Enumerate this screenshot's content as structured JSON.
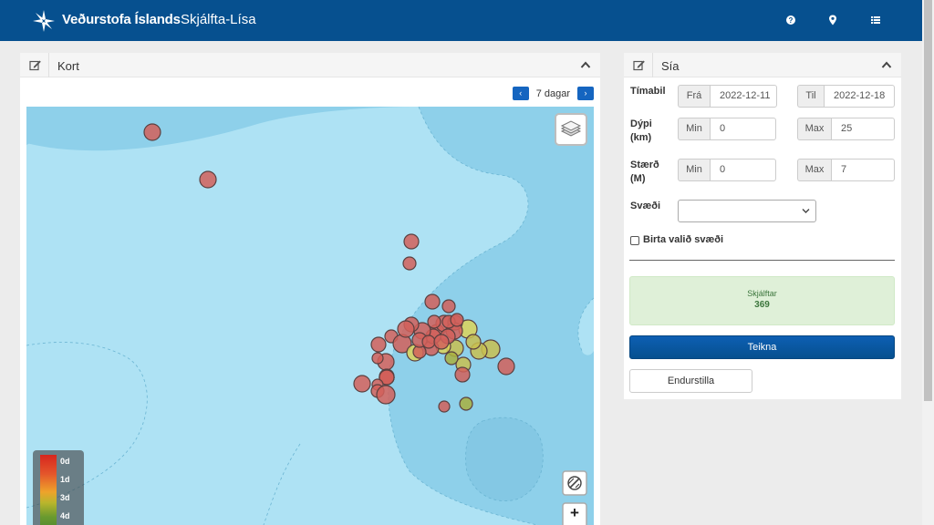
{
  "header": {
    "brand": "Veðurstofa Íslands",
    "app_title": "Skjálfta-Lísa",
    "icons": [
      "help-icon",
      "map-marker-icon",
      "list-icon"
    ],
    "color": "#06508f"
  },
  "map_panel": {
    "title": "Kort",
    "days_label": "7 dagar",
    "prev_symbol": "‹",
    "next_symbol": "›",
    "zoom_in_symbol": "+",
    "legend": [
      "0d",
      "1d",
      "3d",
      "4d"
    ]
  },
  "filter_panel": {
    "title": "Sía",
    "period": {
      "label": "Tímabil",
      "from_addon": "Frá",
      "from_value": "2022-12-11",
      "to_addon": "Til",
      "to_value": "2022-12-18"
    },
    "depth": {
      "label": "Dýpi (km)",
      "min_addon": "Min",
      "min_value": "0",
      "max_addon": "Max",
      "max_value": "25"
    },
    "magnitude": {
      "label": "Stærð (M)",
      "min_addon": "Min",
      "min_value": "0",
      "max_addon": "Max",
      "max_value": "7"
    },
    "region": {
      "label": "Svæði",
      "value": ""
    },
    "show_region_label": "Birta valið svæði",
    "show_region_checked": false,
    "count": {
      "title": "Skjálftar",
      "value": "369"
    },
    "draw_button": "Teikna",
    "reset_button": "Endurstilla"
  }
}
